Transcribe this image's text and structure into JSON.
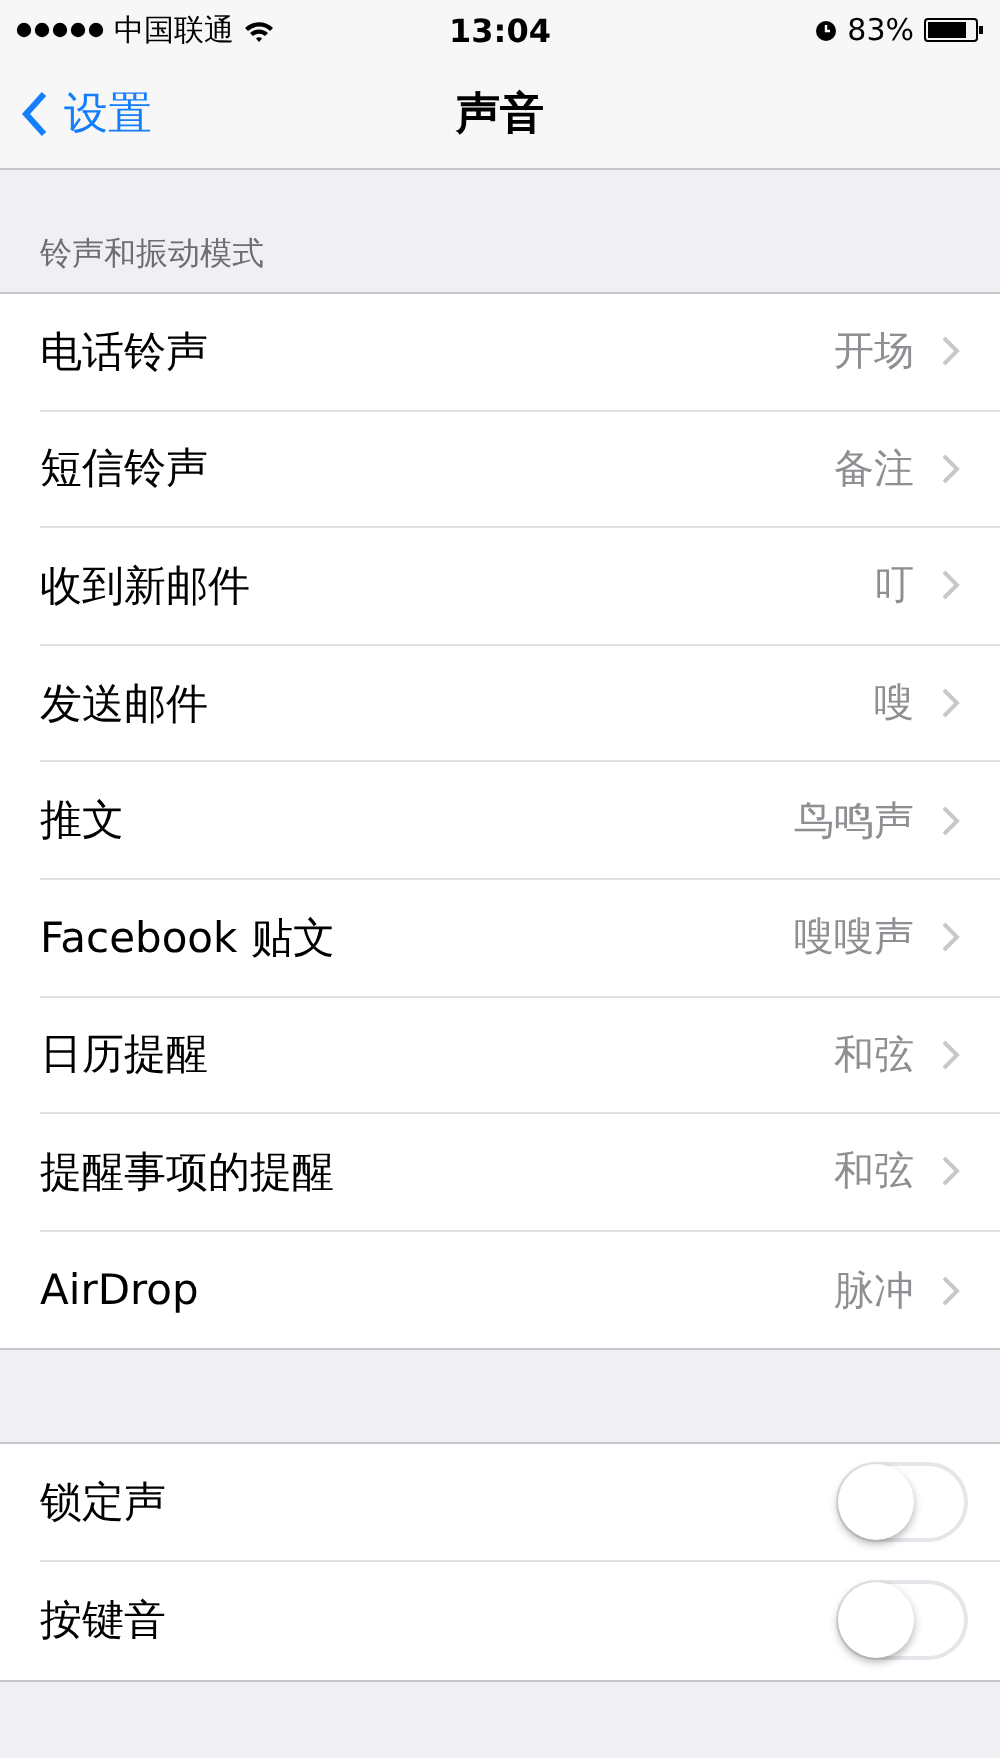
{
  "status_bar": {
    "carrier": "中国联通",
    "time": "13:04",
    "battery": "83%"
  },
  "nav": {
    "back": "设置",
    "title": "声音"
  },
  "section": {
    "header": "铃声和振动模式",
    "rows": [
      {
        "label": "电话铃声",
        "value": "开场"
      },
      {
        "label": "短信铃声",
        "value": "备注"
      },
      {
        "label": "收到新邮件",
        "value": "叮"
      },
      {
        "label": "发送邮件",
        "value": "嗖"
      },
      {
        "label": "推文",
        "value": "鸟鸣声"
      },
      {
        "label": "Facebook 贴文",
        "value": "嗖嗖声"
      },
      {
        "label": "日历提醒",
        "value": "和弦"
      },
      {
        "label": "提醒事项的提醒",
        "value": "和弦"
      },
      {
        "label": "AirDrop",
        "value": "脉冲"
      }
    ]
  },
  "toggles": [
    {
      "label": "锁定声",
      "on": false
    },
    {
      "label": "按键音",
      "on": false
    }
  ]
}
